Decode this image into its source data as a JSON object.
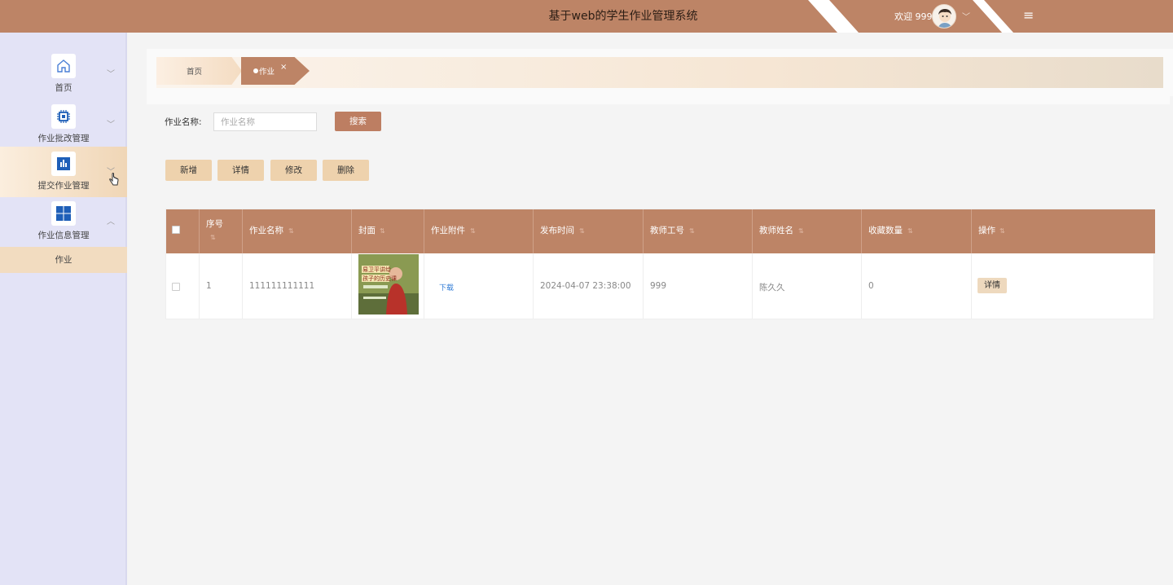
{
  "header": {
    "title": "基于web的学生作业管理系统",
    "welcome": "欢迎 999",
    "user_chevron": "﹀",
    "menu_icon": "≡",
    "colors": {
      "brand": "#bd8466"
    }
  },
  "sidebar": {
    "items": [
      {
        "label": "首页",
        "icon": "home-icon",
        "chevron": "﹀"
      },
      {
        "label": "作业批改管理",
        "icon": "chip-icon",
        "chevron": "﹀"
      },
      {
        "label": "提交作业管理",
        "icon": "chart-bar-icon",
        "chevron": "﹀"
      },
      {
        "label": "作业信息管理",
        "icon": "windows-grid-icon",
        "chevron": "︿"
      }
    ],
    "sub_item": "作业"
  },
  "tabs": {
    "home": "首页",
    "current": "作业",
    "close": "×"
  },
  "search": {
    "label": "作业名称:",
    "placeholder": "作业名称",
    "button": "搜索"
  },
  "toolbar": {
    "add": "新增",
    "detail": "详情",
    "edit": "修改",
    "delete": "删除"
  },
  "table": {
    "columns": [
      "序号",
      "作业名称",
      "封面",
      "作业附件",
      "发布时间",
      "教师工号",
      "教师姓名",
      "收藏数量",
      "操作"
    ],
    "sort_icon": "⇅",
    "rows": [
      {
        "index": "1",
        "name": "111111111111",
        "cover_text_1": "易卫平讲给",
        "cover_text_2": "孩子的历史课",
        "attachment": "下载",
        "publish_time": "2024-04-07 23:38:00",
        "teacher_id": "999",
        "teacher_name": "陈久久",
        "favorites": "0",
        "action": "详情"
      }
    ]
  }
}
